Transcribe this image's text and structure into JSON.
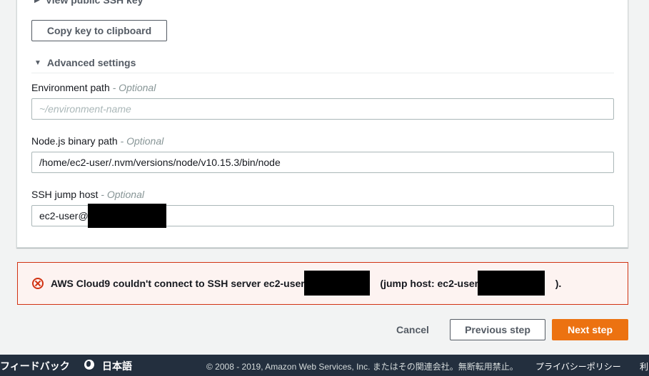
{
  "ssh_key_section": {
    "view_key_label": "View public SSH key",
    "copy_button": "Copy key to clipboard"
  },
  "advanced": {
    "toggle_label": "Advanced settings",
    "optional_suffix": "- Optional",
    "environment_path": {
      "label": "Environment path",
      "placeholder": "~/environment-name",
      "value": ""
    },
    "node_binary_path": {
      "label": "Node.js binary path",
      "value": "/home/ec2-user/.nvm/versions/node/v10.15.3/bin/node"
    },
    "ssh_jump_host": {
      "label": "SSH jump host",
      "value": "ec2-user@"
    }
  },
  "error_banner": {
    "text_part1": "AWS Cloud9 couldn't connect to SSH server ec2-user@",
    "text_part2": "(jump host: ec2-user@",
    "text_part3": ")."
  },
  "actions": {
    "cancel": "Cancel",
    "previous": "Previous step",
    "next": "Next step"
  },
  "footer": {
    "feedback": "フィードバック",
    "language": "日本語",
    "copyright": "© 2008 - 2019, Amazon Web Services, Inc. またはその関連会社。無断転用禁止。",
    "privacy": "プライバシーポリシー",
    "terms": "利"
  }
}
